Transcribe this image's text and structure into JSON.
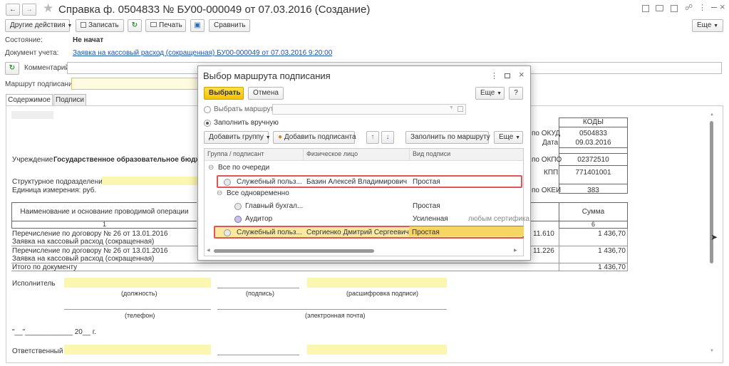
{
  "window": {
    "title": "Справка ф. 0504833 № БУ00-000049 от 07.03.2016 (Создание)"
  },
  "toolbar": {
    "other_actions": "Другие действия",
    "save": "Записать",
    "print": "Печать",
    "compare": "Сравнить",
    "more": "Еще"
  },
  "doc": {
    "state_label": "Состояние:",
    "state_value": "Не начат",
    "accounting_doc_label": "Документ учета:",
    "accounting_doc_value": "Заявка на кассовый расход (сокращенная) БУ00-000049 от 07.03.2016 9:20:00",
    "comment_label": "Комментарий:",
    "route_label": "Маршрут подписания:"
  },
  "tabs": [
    "Содержимое",
    "Подписи"
  ],
  "form": {
    "institution_label": "Учреждение",
    "institution_value": "Государственное образовательное бюджетн",
    "subdivision_label": "Структурное подразделение",
    "unit_label": "Единица измерения: руб.",
    "codes_header": "КОДЫ",
    "codes": [
      {
        "label": "по ОКУД",
        "value": "0504833"
      },
      {
        "label": "Дата",
        "value": "09.03.2016"
      },
      {
        "label": "по ОКПО",
        "value": "02372510"
      },
      {
        "label": "КПП",
        "value": "771401001"
      },
      {
        "label": "по ОКЕИ",
        "value": "383"
      }
    ],
    "op_header": "Наименование и основание проводимой операции",
    "sum_header": "Сумма",
    "col_num_1": "1",
    "col_num_6": "6",
    "rows": [
      {
        "line1": "Перечисление по договору №  26 от 13.01.2016",
        "line2": "Заявка на кассовый расход (сокращенная)",
        "code": "11.610",
        "sum": "1 436,70"
      },
      {
        "line1": "Перечисление по договору №  26 от 13.01.2016",
        "line2": "Заявка на кассовый расход (сокращенная)",
        "code": "11.226",
        "sum": "1 436,70"
      }
    ],
    "total_label": "Итого по документу",
    "total_sum": "1 436,70",
    "executor_label": "Исполнитель",
    "position_caption": "(должность)",
    "signature_caption": "(подпись)",
    "decode_caption": "(расшифровка подписи)",
    "phone_caption": "(телефон)",
    "email_caption": "(электронная почта)",
    "date_line": "\"__\"____________ 20__ г.",
    "responsible_label": "Ответственный"
  },
  "dialog": {
    "title": "Выбор маршрута подписания",
    "select_button": "Выбрать",
    "cancel_button": "Отмена",
    "more_button": "Еще",
    "help_button": "?",
    "radio_route": "Выбрать маршрут",
    "radio_manual": "Заполнить вручную",
    "add_group": "Добавить группу",
    "add_signer": "Добавить подписанта",
    "fill_by_route": "Заполнить по маршруту",
    "more2": "Еще",
    "col_group": "Группа / подписант",
    "col_person": "Физическое лицо",
    "col_type": "Вид подписи",
    "tree": [
      {
        "kind": "group",
        "label": "Все по очереди"
      },
      {
        "kind": "signer",
        "label": "Служебный польз...",
        "person": "Базин Алексей Владимирович",
        "type": "Простая",
        "highlight": true
      },
      {
        "kind": "group",
        "label": "Все одновременно"
      },
      {
        "kind": "signer",
        "label": "Главный бухгал...",
        "person": "",
        "type": "Простая"
      },
      {
        "kind": "signer",
        "label": "Аудитор",
        "person": "",
        "type": "Усиленная",
        "extra": "любым сертифика"
      },
      {
        "kind": "signer",
        "label": "Служебный польз...",
        "person": "Сергиенко Дмитрий Сергеевич",
        "type": "Простая",
        "highlight": true,
        "selected": true
      }
    ]
  }
}
